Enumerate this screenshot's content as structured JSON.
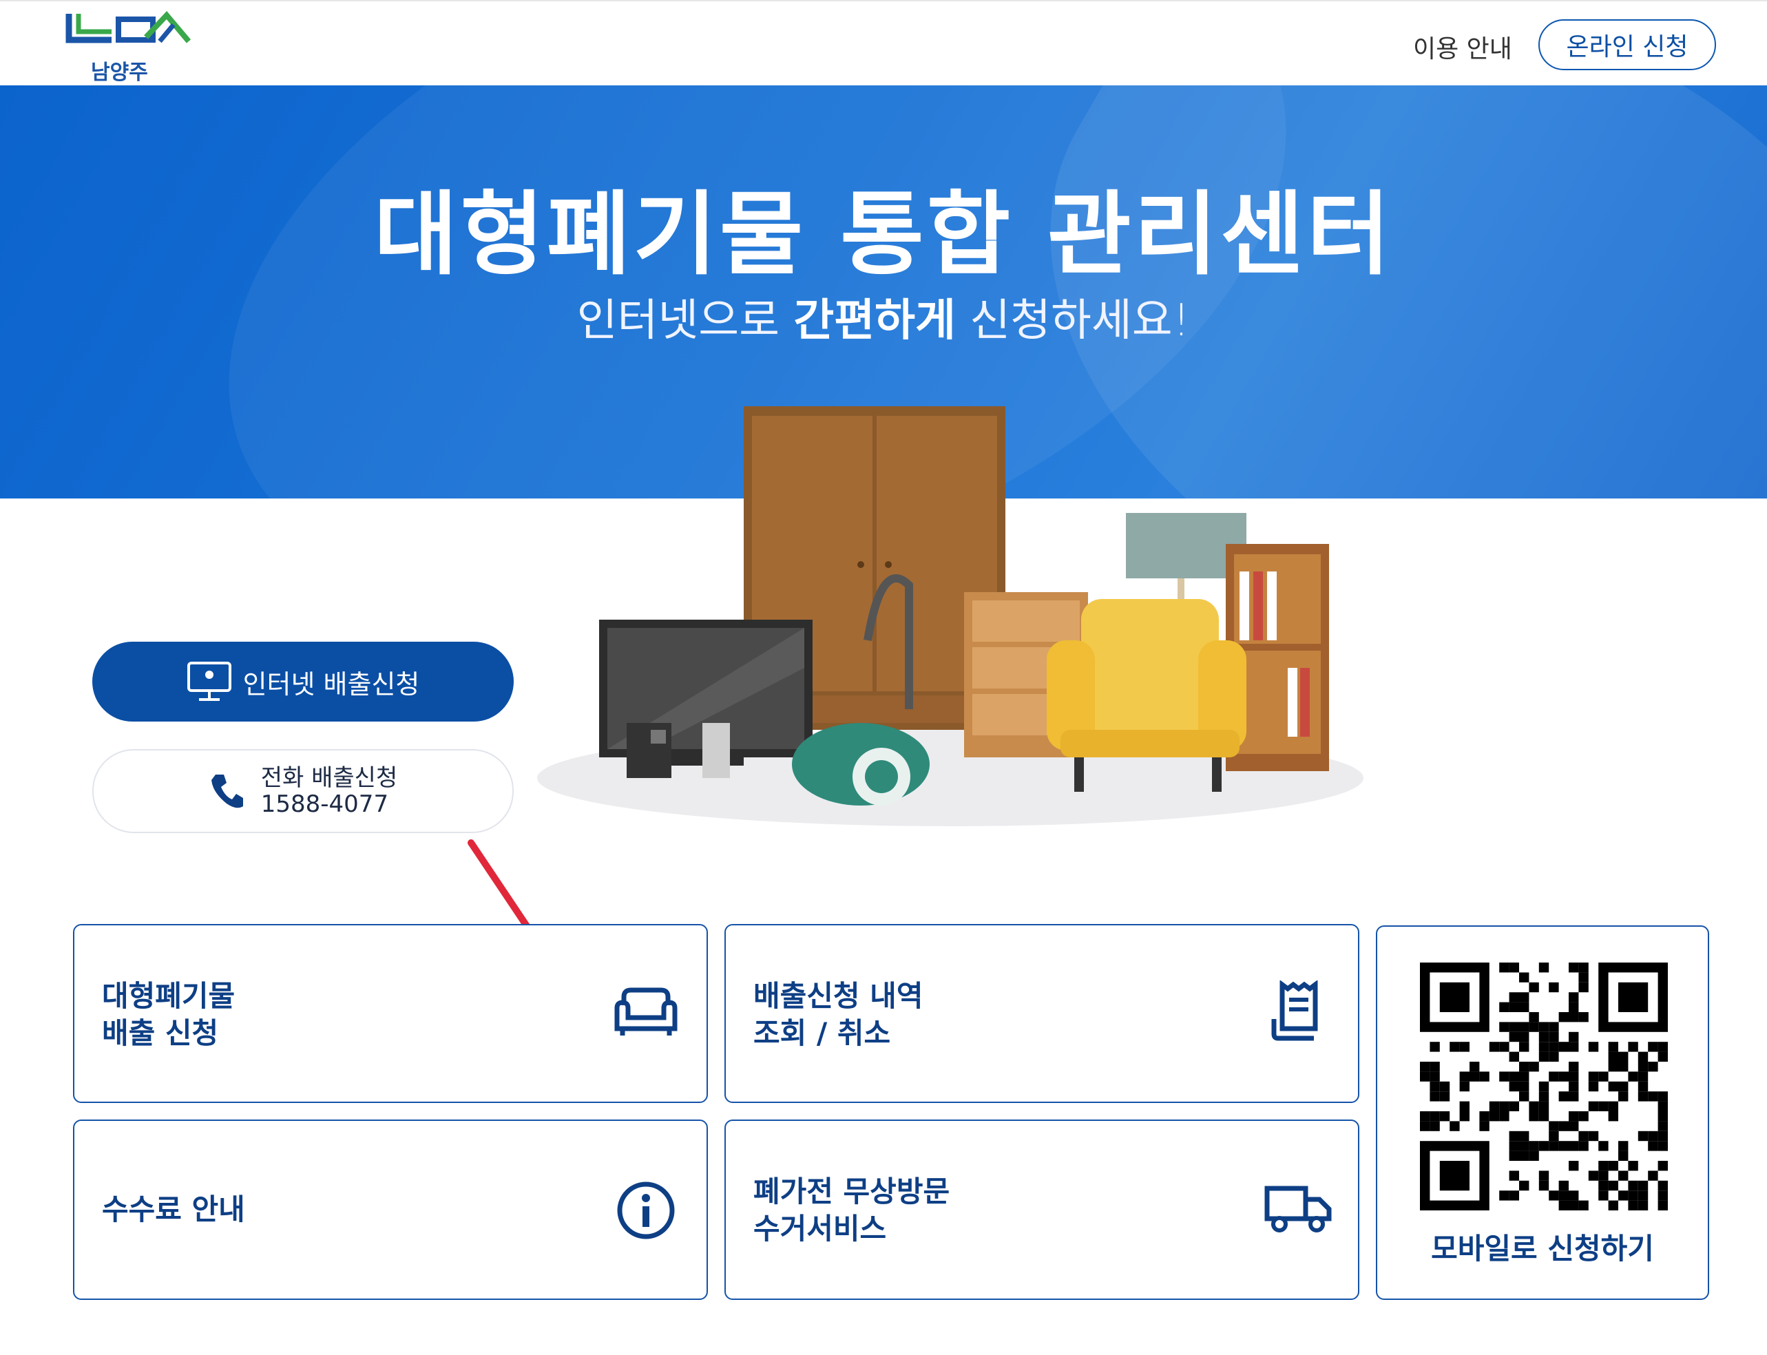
{
  "header": {
    "logo_text": "남양주",
    "nav_guide": "이용 안내",
    "nav_apply": "온라인 신청"
  },
  "hero": {
    "title": "대형폐기물 통합 관리센터",
    "subtitle_pre": "인터넷으로 ",
    "subtitle_bold": "간편하게",
    "subtitle_post": " 신청하세요!"
  },
  "actions": {
    "internet_label": "인터넷 배출신청",
    "phone_label": "전화 배출신청",
    "phone_number": "1588-4077"
  },
  "cards": [
    {
      "line1": "대형폐기물",
      "line2": "배출 신청",
      "icon": "sofa-icon"
    },
    {
      "line1": "배출신청 내역",
      "line2": "조회 / 취소",
      "icon": "receipt-icon"
    },
    {
      "line1": "수수료 안내",
      "line2": "",
      "icon": "info-icon"
    },
    {
      "line1": "폐가전 무상방문",
      "line2": "수거서비스",
      "icon": "truck-icon"
    }
  ],
  "qr": {
    "label": "모바일로 신청하기"
  },
  "colors": {
    "primary": "#0b4fa5",
    "hero_blue": "#1a73d6",
    "card_border": "#1553a8",
    "annotation_arrow": "#e0283a"
  }
}
